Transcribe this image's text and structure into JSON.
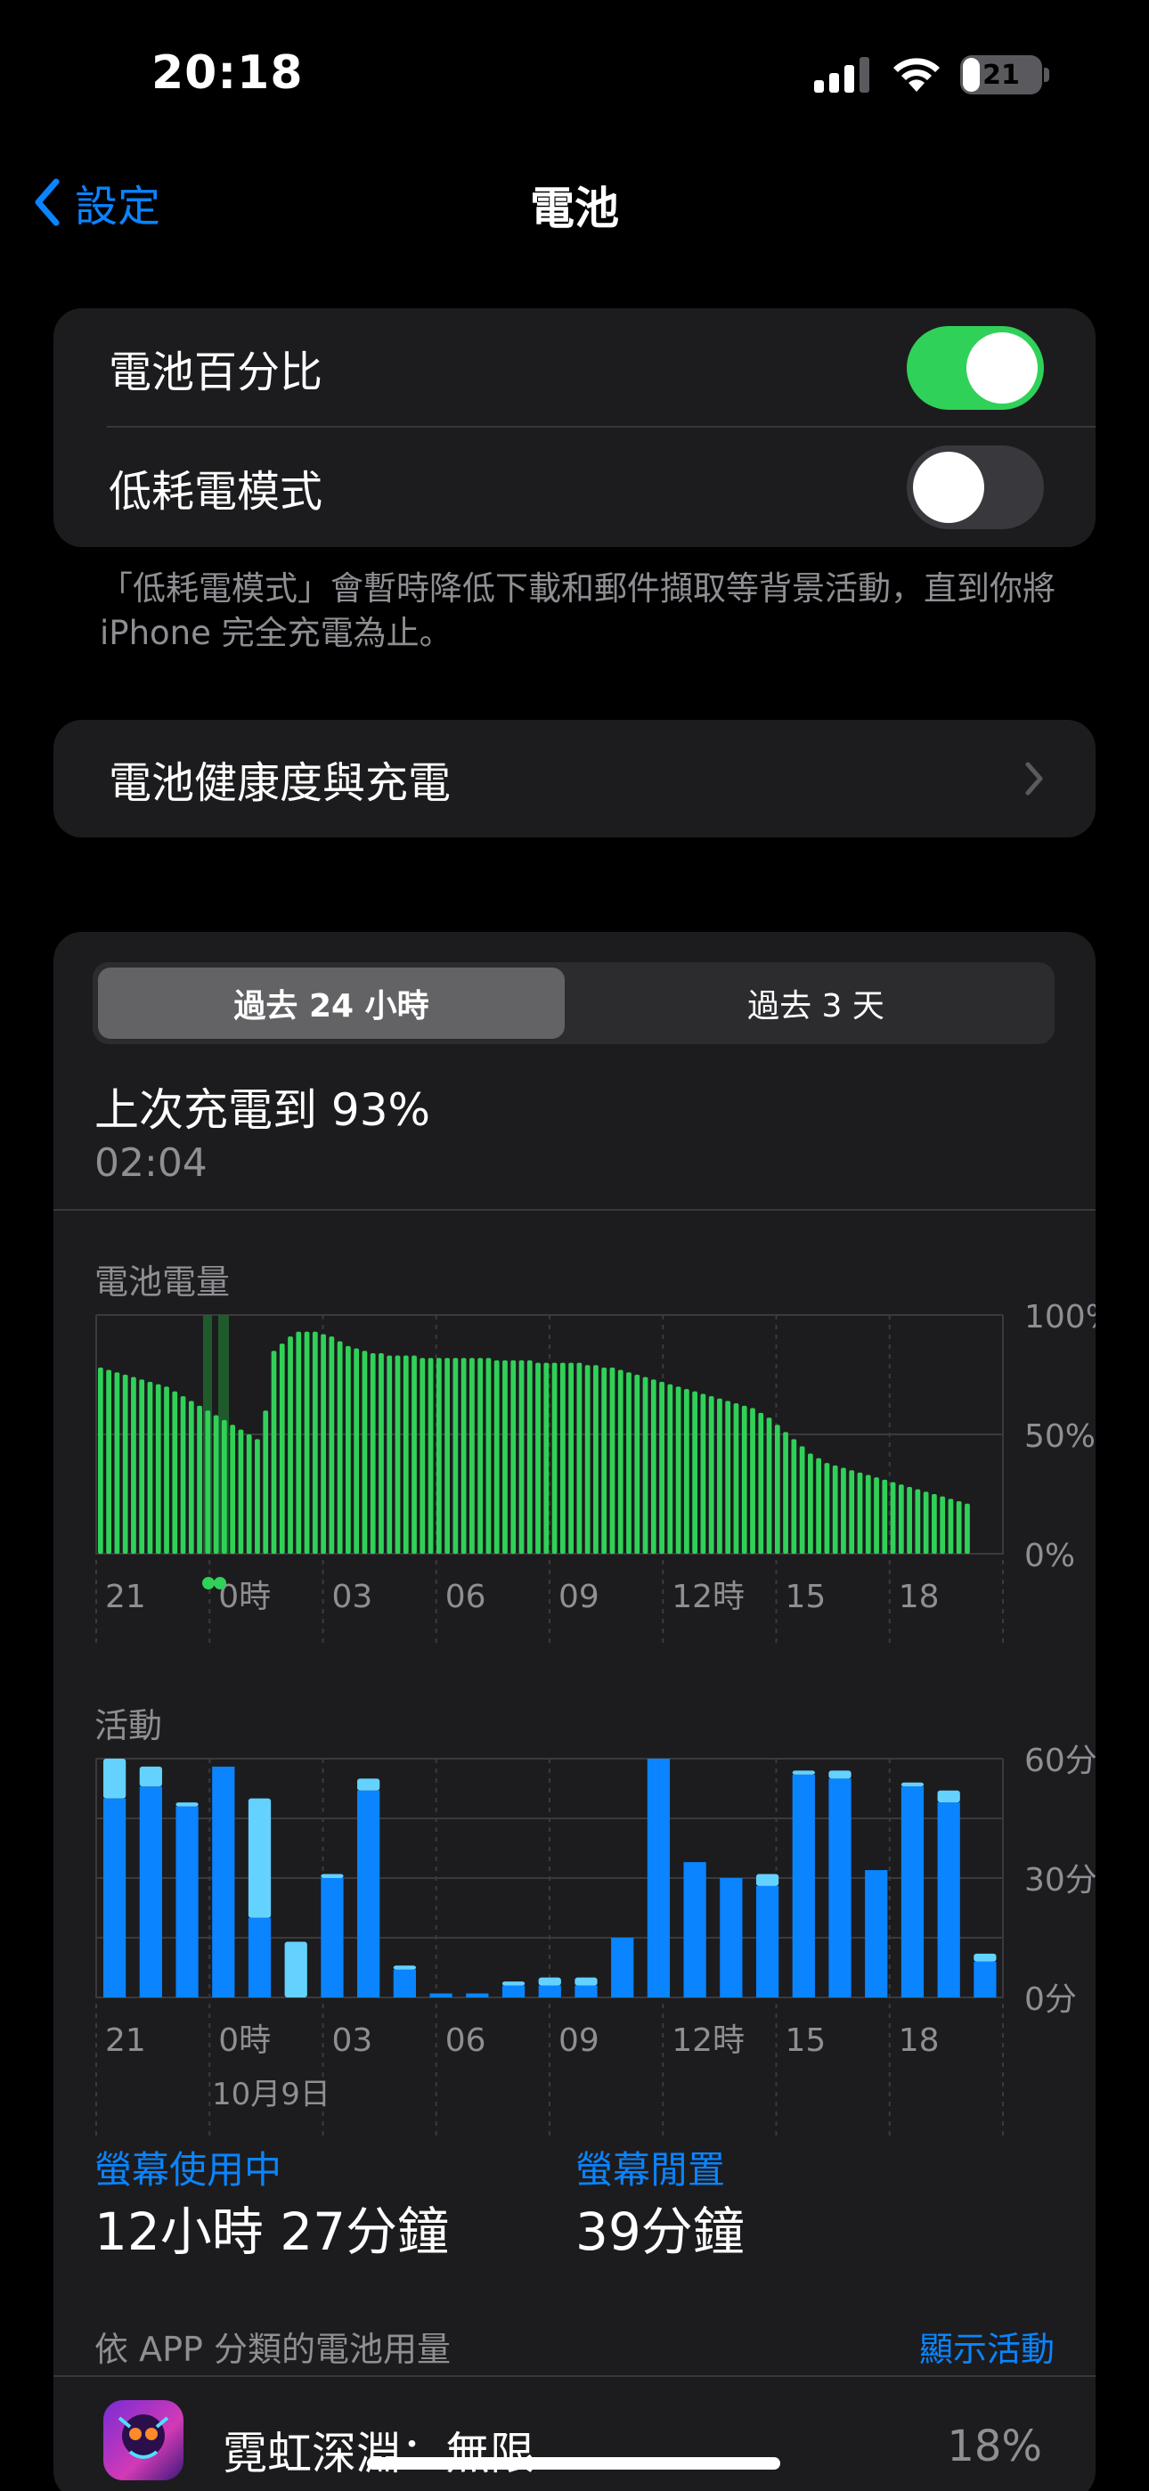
{
  "status": {
    "time": "20:18",
    "battery_level": "21"
  },
  "nav": {
    "back_label": "設定",
    "title": "電池"
  },
  "settings": {
    "battery_percentage": {
      "label": "電池百分比",
      "on": true
    },
    "low_power": {
      "label": "低耗電模式",
      "on": false
    }
  },
  "footnote": "「低耗電模式」會暫時降低下載和郵件擷取等背景活動，直到你將 iPhone 完全充電為止。",
  "health_row": {
    "label": "電池健康度與充電"
  },
  "segmented": {
    "active": "過去 24 小時",
    "inactive": "過去 3 天"
  },
  "last_charge": {
    "label": "上次充電到 93%",
    "time": "02:04"
  },
  "battery_chart": {
    "title": "電池電量",
    "y_labels": [
      "100%",
      "50%",
      "0%"
    ],
    "x_labels": [
      "21",
      "0時",
      "03",
      "06",
      "09",
      "12時",
      "15",
      "18"
    ],
    "bar_color": "#30d158",
    "charging_color": "#1f5a2c"
  },
  "activity_chart": {
    "title": "活動",
    "y_labels": [
      "60分",
      "30分",
      "0分"
    ],
    "x_labels": [
      "21",
      "0時",
      "03",
      "06",
      "09",
      "12時",
      "15",
      "18"
    ],
    "date_label": "10月9日",
    "screen_on_color": "#0a84ff",
    "screen_off_color": "#64d2ff"
  },
  "chart_data": [
    {
      "type": "bar",
      "title": "電池電量",
      "x_labels": [
        "21",
        "0時",
        "03",
        "06",
        "09",
        "12時",
        "15",
        "18"
      ],
      "ylim": [
        0,
        100
      ],
      "values": [
        78,
        77,
        76,
        75,
        74,
        73,
        72,
        71,
        70,
        68,
        66,
        64,
        62,
        60,
        58,
        56,
        54,
        52,
        50,
        48,
        60,
        85,
        88,
        91,
        93,
        93,
        93,
        92,
        91,
        89,
        87,
        86,
        85,
        84,
        84,
        83,
        83,
        83,
        83,
        82,
        82,
        82,
        82,
        82,
        82,
        82,
        82,
        82,
        81,
        81,
        81,
        81,
        81,
        80,
        80,
        80,
        80,
        80,
        80,
        79,
        79,
        78,
        78,
        77,
        76,
        75,
        74,
        73,
        72,
        71,
        70,
        69,
        68,
        67,
        66,
        65,
        64,
        63,
        62,
        61,
        59,
        57,
        54,
        51,
        48,
        45,
        42,
        40,
        38,
        37,
        36,
        35,
        34,
        33,
        32,
        31,
        30,
        29,
        28,
        27,
        26,
        25,
        24,
        23,
        22,
        21
      ]
    },
    {
      "type": "bar",
      "title": "活動",
      "x_labels": [
        "21",
        "0時",
        "03",
        "06",
        "09",
        "12時",
        "15",
        "18"
      ],
      "ylim": [
        0,
        60
      ],
      "series": [
        {
          "name": "螢幕使用中",
          "values": [
            50,
            53,
            48,
            58,
            20,
            0,
            30,
            52,
            7,
            1,
            1,
            3,
            3,
            3,
            15,
            60,
            34,
            30,
            28,
            56,
            55,
            32,
            53,
            49,
            9
          ]
        },
        {
          "name": "螢幕閒置",
          "values": [
            10,
            5,
            1,
            0,
            30,
            14,
            1,
            3,
            1,
            0,
            0,
            1,
            2,
            2,
            0,
            0,
            0,
            0,
            3,
            1,
            2,
            0,
            1,
            3,
            2
          ]
        }
      ]
    }
  ],
  "stats": {
    "screen_on_label": "螢幕使用中",
    "screen_on_value": "12小時 27分鐘",
    "screen_off_label": "螢幕閒置",
    "screen_off_value": "39分鐘"
  },
  "app_usage": {
    "heading": "依 APP 分類的電池用量",
    "show_activity": "顯示活動",
    "apps": [
      {
        "name": "霓虹深淵：無限",
        "percent": "18%"
      }
    ]
  }
}
